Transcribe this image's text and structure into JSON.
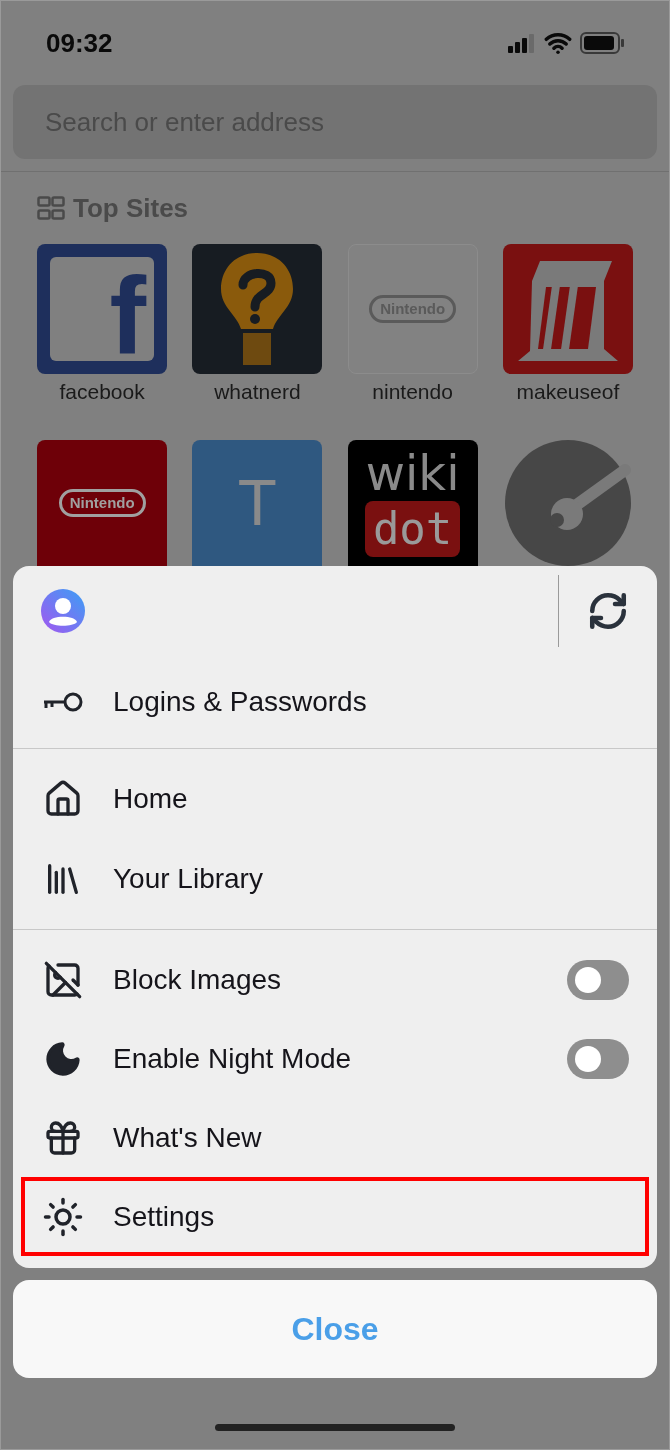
{
  "status_bar": {
    "time": "09:32"
  },
  "search": {
    "placeholder": "Search or enter address"
  },
  "top_sites": {
    "title": "Top Sites",
    "tiles": [
      {
        "kind": "framed-letter",
        "glyph": "f",
        "color": "#1e2f5c",
        "label": "facebook"
      },
      {
        "kind": "bulb",
        "color": "#171c22",
        "label": "whatnerd"
      },
      {
        "kind": "pill",
        "glyph": "Nintendo",
        "color": "#828282",
        "label": "nintendo"
      },
      {
        "kind": "m-logo",
        "color": "#7a1010",
        "label": "makeuseof"
      },
      {
        "kind": "pill",
        "glyph": "Nintendo",
        "color": "#6e0008"
      },
      {
        "kind": "letter",
        "glyph": "T",
        "color": "#2f5880"
      },
      {
        "kind": "wiki",
        "glyph": "wiki",
        "glyph2": "dot",
        "color": "#000000"
      },
      {
        "kind": "wrench",
        "color": "#808080"
      }
    ]
  },
  "menu": {
    "sections": [
      [
        {
          "kind": "link",
          "label": "Logins & Passwords",
          "highlighted": false
        }
      ],
      [
        {
          "kind": "link",
          "label": "Home",
          "highlighted": false
        },
        {
          "kind": "link",
          "label": "Your Library",
          "highlighted": false
        }
      ],
      [
        {
          "kind": "toggle",
          "label": "Block Images",
          "on": false,
          "highlighted": false
        },
        {
          "kind": "toggle",
          "label": "Enable Night Mode",
          "on": false,
          "highlighted": false
        },
        {
          "kind": "link",
          "label": "What's New",
          "highlighted": false
        },
        {
          "kind": "link",
          "label": "Settings",
          "highlighted": true
        }
      ]
    ]
  },
  "close_button": "Close"
}
